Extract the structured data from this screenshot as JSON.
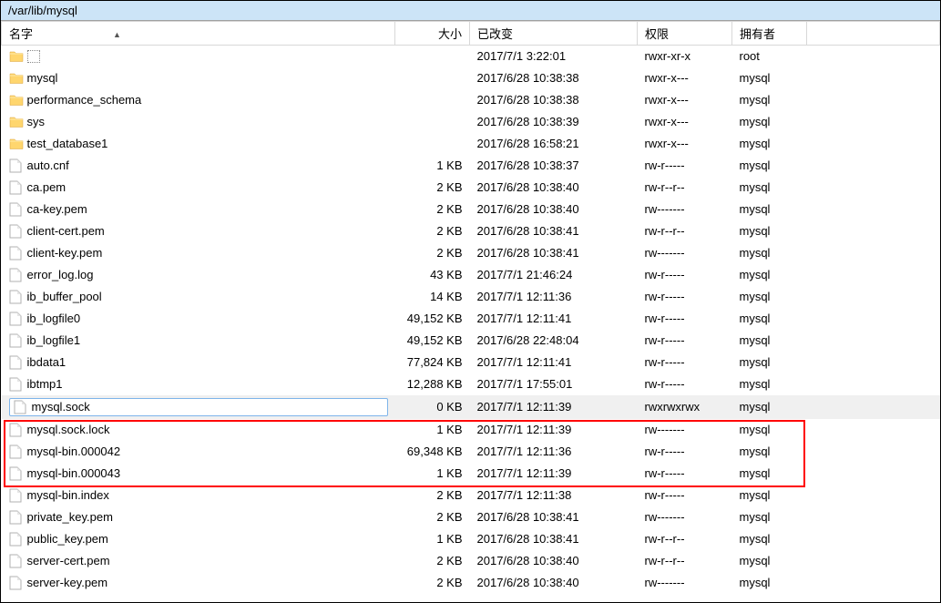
{
  "path": "/var/lib/mysql",
  "columns": {
    "name": "名字",
    "size": "大小",
    "changed": "已改变",
    "perm": "权限",
    "owner": "拥有者"
  },
  "rows": [
    {
      "type": "up",
      "name": "..",
      "size": "",
      "changed": "2017/7/1 3:22:01",
      "perm": "rwxr-xr-x",
      "owner": "root",
      "sel": false,
      "hl": false
    },
    {
      "type": "folder",
      "name": "mysql",
      "size": "",
      "changed": "2017/6/28 10:38:38",
      "perm": "rwxr-x---",
      "owner": "mysql",
      "sel": false,
      "hl": false
    },
    {
      "type": "folder",
      "name": "performance_schema",
      "size": "",
      "changed": "2017/6/28 10:38:38",
      "perm": "rwxr-x---",
      "owner": "mysql",
      "sel": false,
      "hl": false
    },
    {
      "type": "folder",
      "name": "sys",
      "size": "",
      "changed": "2017/6/28 10:38:39",
      "perm": "rwxr-x---",
      "owner": "mysql",
      "sel": false,
      "hl": false
    },
    {
      "type": "folder",
      "name": "test_database1",
      "size": "",
      "changed": "2017/6/28 16:58:21",
      "perm": "rwxr-x---",
      "owner": "mysql",
      "sel": false,
      "hl": false
    },
    {
      "type": "file",
      "name": "auto.cnf",
      "size": "1 KB",
      "changed": "2017/6/28 10:38:37",
      "perm": "rw-r-----",
      "owner": "mysql",
      "sel": false,
      "hl": false
    },
    {
      "type": "file",
      "name": "ca.pem",
      "size": "2 KB",
      "changed": "2017/6/28 10:38:40",
      "perm": "rw-r--r--",
      "owner": "mysql",
      "sel": false,
      "hl": false
    },
    {
      "type": "file",
      "name": "ca-key.pem",
      "size": "2 KB",
      "changed": "2017/6/28 10:38:40",
      "perm": "rw-------",
      "owner": "mysql",
      "sel": false,
      "hl": false
    },
    {
      "type": "file",
      "name": "client-cert.pem",
      "size": "2 KB",
      "changed": "2017/6/28 10:38:41",
      "perm": "rw-r--r--",
      "owner": "mysql",
      "sel": false,
      "hl": false
    },
    {
      "type": "file",
      "name": "client-key.pem",
      "size": "2 KB",
      "changed": "2017/6/28 10:38:41",
      "perm": "rw-------",
      "owner": "mysql",
      "sel": false,
      "hl": false
    },
    {
      "type": "file",
      "name": "error_log.log",
      "size": "43 KB",
      "changed": "2017/7/1 21:46:24",
      "perm": "rw-r-----",
      "owner": "mysql",
      "sel": false,
      "hl": false
    },
    {
      "type": "file",
      "name": "ib_buffer_pool",
      "size": "14 KB",
      "changed": "2017/7/1 12:11:36",
      "perm": "rw-r-----",
      "owner": "mysql",
      "sel": false,
      "hl": false
    },
    {
      "type": "file",
      "name": "ib_logfile0",
      "size": "49,152 KB",
      "changed": "2017/7/1 12:11:41",
      "perm": "rw-r-----",
      "owner": "mysql",
      "sel": false,
      "hl": false
    },
    {
      "type": "file",
      "name": "ib_logfile1",
      "size": "49,152 KB",
      "changed": "2017/6/28 22:48:04",
      "perm": "rw-r-----",
      "owner": "mysql",
      "sel": false,
      "hl": false
    },
    {
      "type": "file",
      "name": "ibdata1",
      "size": "77,824 KB",
      "changed": "2017/7/1 12:11:41",
      "perm": "rw-r-----",
      "owner": "mysql",
      "sel": false,
      "hl": false
    },
    {
      "type": "file",
      "name": "ibtmp1",
      "size": "12,288 KB",
      "changed": "2017/7/1 17:55:01",
      "perm": "rw-r-----",
      "owner": "mysql",
      "sel": false,
      "hl": false
    },
    {
      "type": "file",
      "name": "mysql.sock",
      "size": "0 KB",
      "changed": "2017/7/1 12:11:39",
      "perm": "rwxrwxrwx",
      "owner": "mysql",
      "sel": true,
      "hl": false
    },
    {
      "type": "file",
      "name": "mysql.sock.lock",
      "size": "1 KB",
      "changed": "2017/7/1 12:11:39",
      "perm": "rw-------",
      "owner": "mysql",
      "sel": false,
      "hl": false
    },
    {
      "type": "file",
      "name": "mysql-bin.000042",
      "size": "69,348 KB",
      "changed": "2017/7/1 12:11:36",
      "perm": "rw-r-----",
      "owner": "mysql",
      "sel": false,
      "hl": true
    },
    {
      "type": "file",
      "name": "mysql-bin.000043",
      "size": "1 KB",
      "changed": "2017/7/1 12:11:39",
      "perm": "rw-r-----",
      "owner": "mysql",
      "sel": false,
      "hl": true
    },
    {
      "type": "file",
      "name": "mysql-bin.index",
      "size": "2 KB",
      "changed": "2017/7/1 12:11:38",
      "perm": "rw-r-----",
      "owner": "mysql",
      "sel": false,
      "hl": true
    },
    {
      "type": "file",
      "name": "private_key.pem",
      "size": "2 KB",
      "changed": "2017/6/28 10:38:41",
      "perm": "rw-------",
      "owner": "mysql",
      "sel": false,
      "hl": false
    },
    {
      "type": "file",
      "name": "public_key.pem",
      "size": "1 KB",
      "changed": "2017/6/28 10:38:41",
      "perm": "rw-r--r--",
      "owner": "mysql",
      "sel": false,
      "hl": false
    },
    {
      "type": "file",
      "name": "server-cert.pem",
      "size": "2 KB",
      "changed": "2017/6/28 10:38:40",
      "perm": "rw-r--r--",
      "owner": "mysql",
      "sel": false,
      "hl": false
    },
    {
      "type": "file",
      "name": "server-key.pem",
      "size": "2 KB",
      "changed": "2017/6/28 10:38:40",
      "perm": "rw-------",
      "owner": "mysql",
      "sel": false,
      "hl": false
    }
  ]
}
